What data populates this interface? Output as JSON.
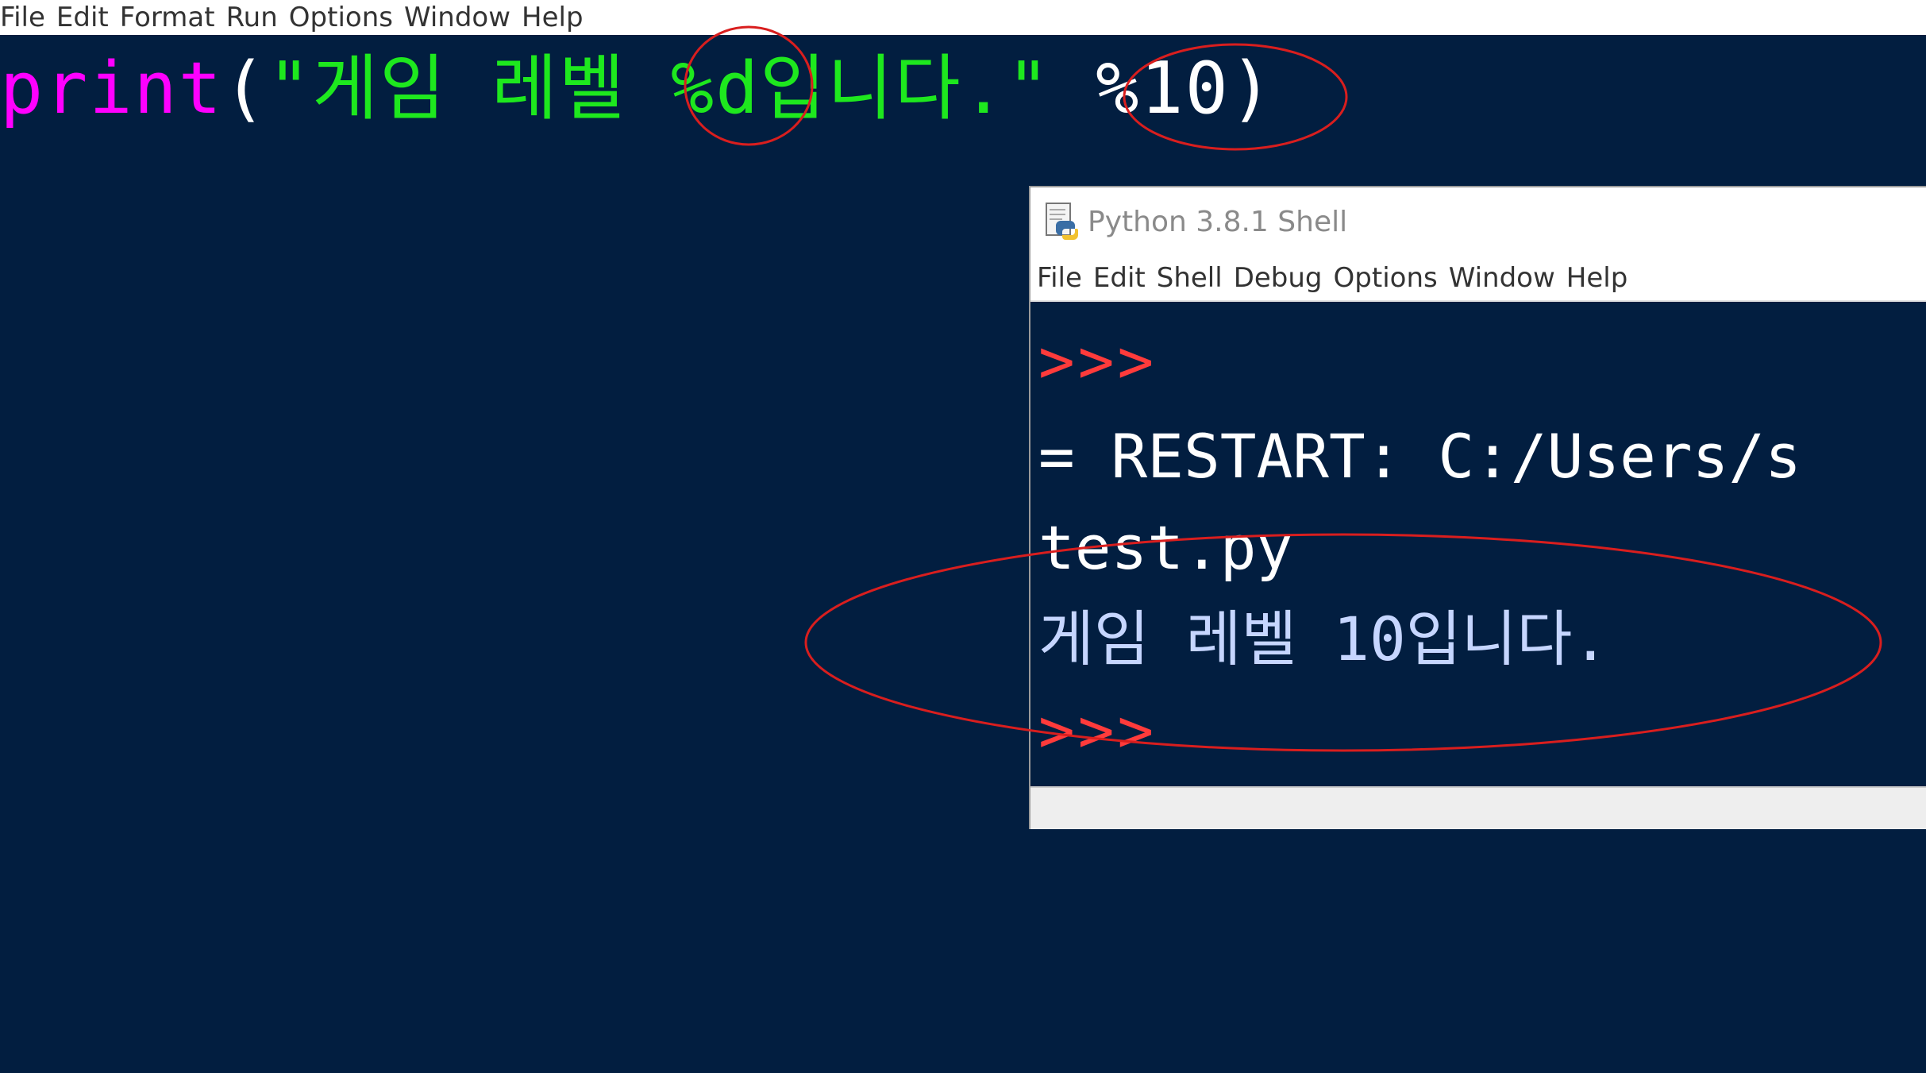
{
  "editor": {
    "menu": [
      "File",
      "Edit",
      "Format",
      "Run",
      "Options",
      "Window",
      "Help"
    ],
    "code": {
      "builtin": "print",
      "open_paren": "(",
      "string_literal": "\"게임 레벨 %d입니다.\"",
      "space": " ",
      "operator_arg": "%10",
      "close_paren": ")"
    }
  },
  "shell": {
    "title": "Python 3.8.1 Shell",
    "icon": "python-idle-icon",
    "menu": [
      "File",
      "Edit",
      "Shell",
      "Debug",
      "Options",
      "Window",
      "Help"
    ],
    "lines": {
      "prompt_1": ">>>",
      "restart": "= RESTART: C:/Users/s",
      "filename": "test.py",
      "output": "게임 레벨 10입니다.",
      "prompt_2": ">>>"
    }
  },
  "colors": {
    "background": "#021e40",
    "builtin": "#ff00ff",
    "string": "#1ee81e",
    "prompt": "#ff3b3b",
    "output": "#c6d6ff",
    "annotation": "#d91e1e"
  }
}
